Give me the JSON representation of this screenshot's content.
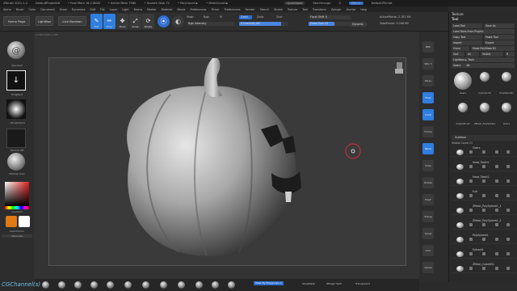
{
  "titlebar": {
    "app": "ZBrush 2021.1.2",
    "project": "DefaultProject48",
    "free_mem": "• Free Mem 16.218GB",
    "active_mem": "• Active Mem 7960",
    "scratch": "• Scratch Disk 72",
    "polycount": "• PolyCount ►",
    "meshcount": "• MeshCount ►",
    "quicksave": "QuickSave",
    "see_through": "See-through",
    "see_through_val": "0",
    "menus_btn": "Menus",
    "defaultzscript": "DefaultZScript"
  },
  "menubar": [
    "Alpha",
    "Brush",
    "Color",
    "Document",
    "Draw",
    "Dynamics",
    "Edit",
    "File",
    "Layer",
    "Light",
    "Macro",
    "Marker",
    "Material",
    "Movie",
    "Preferences",
    "Picker",
    "Preferences",
    "Render",
    "Stencil",
    "Stroke",
    "Texture",
    "Tool",
    "Transform",
    "Zplugin",
    "Zscript",
    "Help"
  ],
  "shelf": {
    "home_page": "Home Page",
    "lightbox": "LightBox",
    "live_boolean": "Live Boolean",
    "tools": [
      {
        "label": "Edit",
        "glyph": "✎",
        "active": true
      },
      {
        "label": "Draw",
        "glyph": "✏",
        "active": true
      },
      {
        "label": "Move",
        "glyph": "✥",
        "active": false
      },
      {
        "label": "Scale",
        "glyph": "⤢",
        "active": false
      },
      {
        "label": "Rotate",
        "glyph": "⟳",
        "active": false
      }
    ],
    "mrgb": "Mrgb",
    "rgb": "Rgb",
    "m": "M",
    "zadd": "Zadd",
    "zsub": "Zsub",
    "zcut": "Zcut",
    "rgb_intensity": "Rgb Intensity",
    "z_intensity": "Z Intensity 86",
    "focal_shift": "Focal Shift 0",
    "draw_size": "Draw Size 93",
    "dynamic": "Dynamic",
    "active_points": "ActivePoints: 2.787 Mil",
    "total_points": "TotalPoints: 5.048 Mil"
  },
  "left": {
    "brush_name": "Standard",
    "stroke_name": "DragRect",
    "alpha_name": "~BrushAlpha",
    "texture_name": "Texture Off",
    "material_name": "MatCap Gray",
    "gradient": "Gradient",
    "switch_color": "SwitchColor",
    "alternate": "Alternate",
    "colors": {
      "main": "#e07a14",
      "secondary": "#ffffff"
    }
  },
  "viewport": {
    "coords": "4.182,0.005,1.185"
  },
  "right": [
    "BPR",
    "SPix 3",
    "Persp",
    "Floor",
    "Local",
    "Frame",
    "Move",
    "Scale",
    "Rotate",
    "PolyF",
    "Transp",
    "Ghost",
    "Solo",
    "Xpose"
  ],
  "panel": {
    "texture": "Texture",
    "tool": "Tool",
    "load_tool": "Load Tool",
    "save_as": "Save As",
    "load_tools_from_project": "Load Tools From Project",
    "copy_tool": "Copy Tool",
    "paste_tool": "Paste Tool",
    "import": "Import",
    "export": "Export",
    "clone": "Clone",
    "make_polymesh": "Make PolyMesh3D",
    "goz": "GoZ",
    "all": "All",
    "visible": "Visible",
    "r": "R",
    "lightbox_tools": "Lightbox ► Tools",
    "gears_label": "Gears",
    "gears_val": "48",
    "thumbs": [
      "Gears",
      "Cylinder3D",
      "PolyMesh3D",
      "SimpleBrush",
      "ZMesh_PolySphere",
      "Gears"
    ],
    "subtool": "Subtool",
    "visible_count": "Visible Count 13",
    "rows": [
      "Gears",
      "Head_Teeth1",
      "Head_Teeth2",
      "Fuit",
      "ZMesh_PolySphere1_1",
      "ZMesh_PolySphere1_2",
      "PolySphere1",
      "Extract4",
      "ZMesh_Cube2D1"
    ]
  },
  "bottom": {
    "mask_by_polygroups": "Mask By Polygroups 0",
    "showmask": "ShowMask",
    "zplugin_sel": "ZPlugin Sel3",
    "transparent": "Transparent",
    "watermark": "CGChannel(s)"
  }
}
